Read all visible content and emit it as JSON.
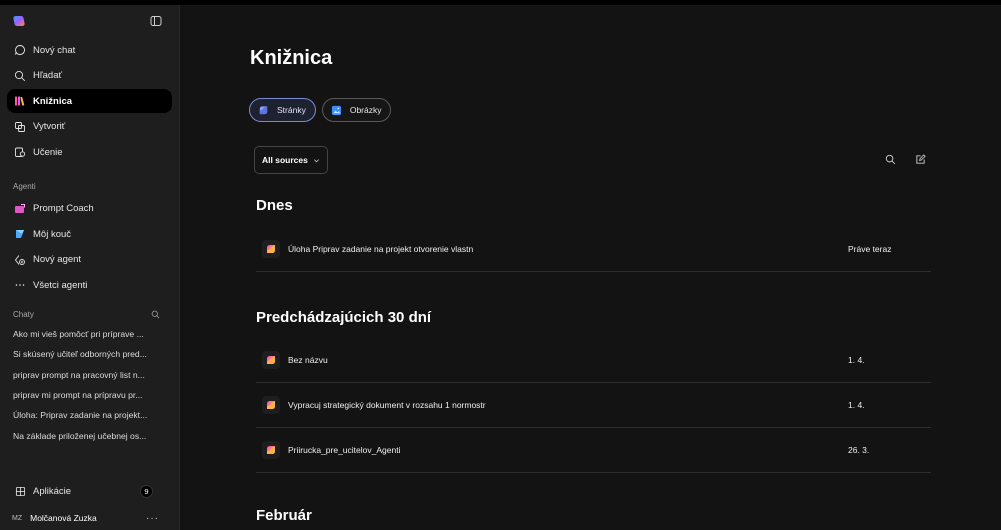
{
  "sidebar": {
    "nav": [
      {
        "label": "Nový chat",
        "icon": "chat-bubble-icon"
      },
      {
        "label": "Hľadať",
        "icon": "search-icon"
      },
      {
        "label": "Knižnica",
        "icon": "library-icon",
        "active": true
      },
      {
        "label": "Vytvoriť",
        "icon": "create-icon"
      },
      {
        "label": "Učenie",
        "icon": "learning-icon"
      }
    ],
    "agents_label": "Agenti",
    "agents": [
      {
        "label": "Prompt Coach",
        "icon": "prompt-coach-icon"
      },
      {
        "label": "Môj kouč",
        "icon": "my-coach-icon"
      },
      {
        "label": "Nový agent",
        "icon": "new-agent-icon"
      },
      {
        "label": "Všetci agenti",
        "icon": "more-icon"
      }
    ],
    "chats_label": "Chaty",
    "chats": [
      "Ako mi vieš pomôcť pri príprave ...",
      "Si skúsený učiteľ odborných pred...",
      "priprav prompt na pracovný list n...",
      "priprav mi prompt na prípravu pr...",
      "Úloha: Priprav zadanie na projekt...",
      "Na základe priloženej učebnej os..."
    ],
    "apps_label": "Aplikácie",
    "apps_badge": "9",
    "user_initials": "MZ",
    "user_name": "Molčanová Zuzka",
    "user_more": "···"
  },
  "main": {
    "title": "Knižnica",
    "tabs": [
      {
        "label": "Stránky",
        "active": true
      },
      {
        "label": "Obrázky",
        "active": false
      }
    ],
    "filter_label": "All sources",
    "sections": [
      {
        "title": "Dnes",
        "rows": [
          {
            "name": "Úloha Priprav zadanie na projekt otvorenie vlastn",
            "date": "Práve teraz"
          }
        ]
      },
      {
        "title": "Predchádzajúcich 30 dní",
        "rows": [
          {
            "name": "Bez názvu",
            "date": "1. 4."
          },
          {
            "name": "Vypracuj strategický dokument v rozsahu 1 normostr",
            "date": "1. 4."
          },
          {
            "name": "Priirucka_pre_ucitelov_Agenti",
            "date": "26. 3."
          }
        ]
      },
      {
        "title": "Február",
        "rows": []
      }
    ]
  },
  "colors": {
    "accent": "#7a8bd6",
    "sidebar_bg": "#1e1e1e",
    "main_bg": "#131313"
  }
}
